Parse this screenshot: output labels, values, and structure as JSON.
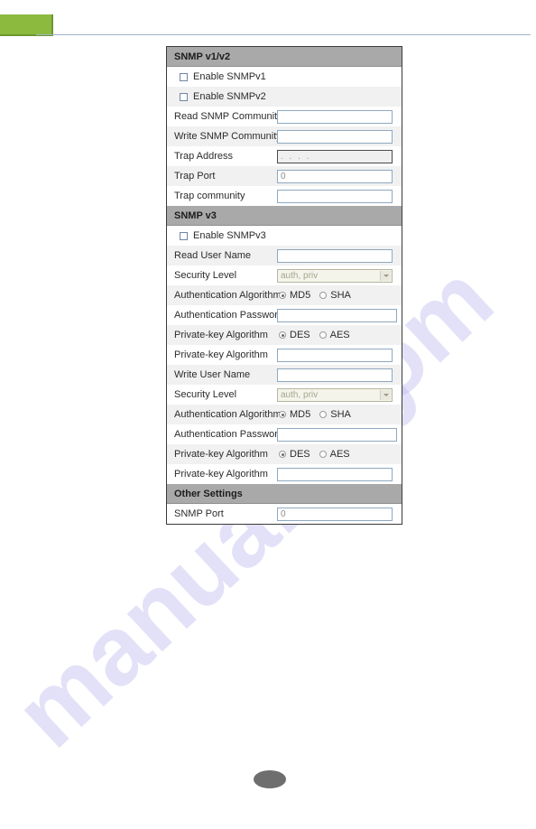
{
  "page": {
    "badge_label": "",
    "watermark_a": "manualslib",
    "watermark_b": ".com"
  },
  "panel": {
    "sections": [
      {
        "id": "snmp-v1-v2",
        "title": "SNMP v1/v2",
        "rows": [
          {
            "type": "checkbox",
            "label": "Enable SNMPv1",
            "checked": false,
            "shade": "plain"
          },
          {
            "type": "checkbox",
            "label": "Enable SNMPv2",
            "checked": false,
            "shade": "alt"
          },
          {
            "type": "text",
            "label": "Read SNMP Community",
            "value": "",
            "shade": "plain",
            "disabled": false
          },
          {
            "type": "text",
            "label": "Write SNMP Community",
            "value": "",
            "shade": "alt",
            "disabled": false
          },
          {
            "type": "text",
            "label": "Trap Address",
            "value": ". . . .",
            "shade": "plain",
            "disabled": true
          },
          {
            "type": "text",
            "label": "Trap Port",
            "value": "0",
            "shade": "alt",
            "disabled": false,
            "grey": true
          },
          {
            "type": "text",
            "label": "Trap community",
            "value": "",
            "shade": "plain",
            "disabled": false
          }
        ]
      },
      {
        "id": "snmp-v3",
        "title": "SNMP v3",
        "rows": [
          {
            "type": "checkbox",
            "label": "Enable SNMPv3",
            "checked": false,
            "shade": "plain"
          },
          {
            "type": "text",
            "label": "Read User Name",
            "value": "",
            "shade": "alt",
            "disabled": false
          },
          {
            "type": "select",
            "label": "Security Level",
            "value": "auth, priv",
            "shade": "plain",
            "options": [
              "auth, priv"
            ]
          },
          {
            "type": "radio",
            "label": "Authentication Algorithm",
            "shade": "alt",
            "options": [
              "MD5",
              "SHA"
            ],
            "selected": "MD5"
          },
          {
            "type": "text",
            "label": "Authentication Password",
            "value": "",
            "shade": "plain",
            "disabled": false,
            "wide": true
          },
          {
            "type": "radio",
            "label": "Private-key Algorithm",
            "shade": "alt",
            "options": [
              "DES",
              "AES"
            ],
            "selected": "DES"
          },
          {
            "type": "text",
            "label": "Private-key Algorithm",
            "value": "",
            "shade": "plain",
            "disabled": false
          },
          {
            "type": "text",
            "label": "Write User Name",
            "value": "",
            "shade": "alt",
            "disabled": false
          },
          {
            "type": "select",
            "label": "Security Level",
            "value": "auth, priv",
            "shade": "plain",
            "options": [
              "auth, priv"
            ]
          },
          {
            "type": "radio",
            "label": "Authentication Algorithm",
            "shade": "alt",
            "options": [
              "MD5",
              "SHA"
            ],
            "selected": "MD5"
          },
          {
            "type": "text",
            "label": "Authentication Password",
            "value": "",
            "shade": "plain",
            "disabled": false,
            "wide": true
          },
          {
            "type": "radio",
            "label": "Private-key Algorithm",
            "shade": "alt",
            "options": [
              "DES",
              "AES"
            ],
            "selected": "DES"
          },
          {
            "type": "text",
            "label": "Private-key Algorithm",
            "value": "",
            "shade": "plain",
            "disabled": false
          }
        ]
      },
      {
        "id": "other-settings",
        "title": "Other Settings",
        "rows": [
          {
            "type": "text",
            "label": "SNMP Port",
            "value": "0",
            "shade": "plain",
            "disabled": false,
            "grey": true
          }
        ]
      }
    ]
  }
}
